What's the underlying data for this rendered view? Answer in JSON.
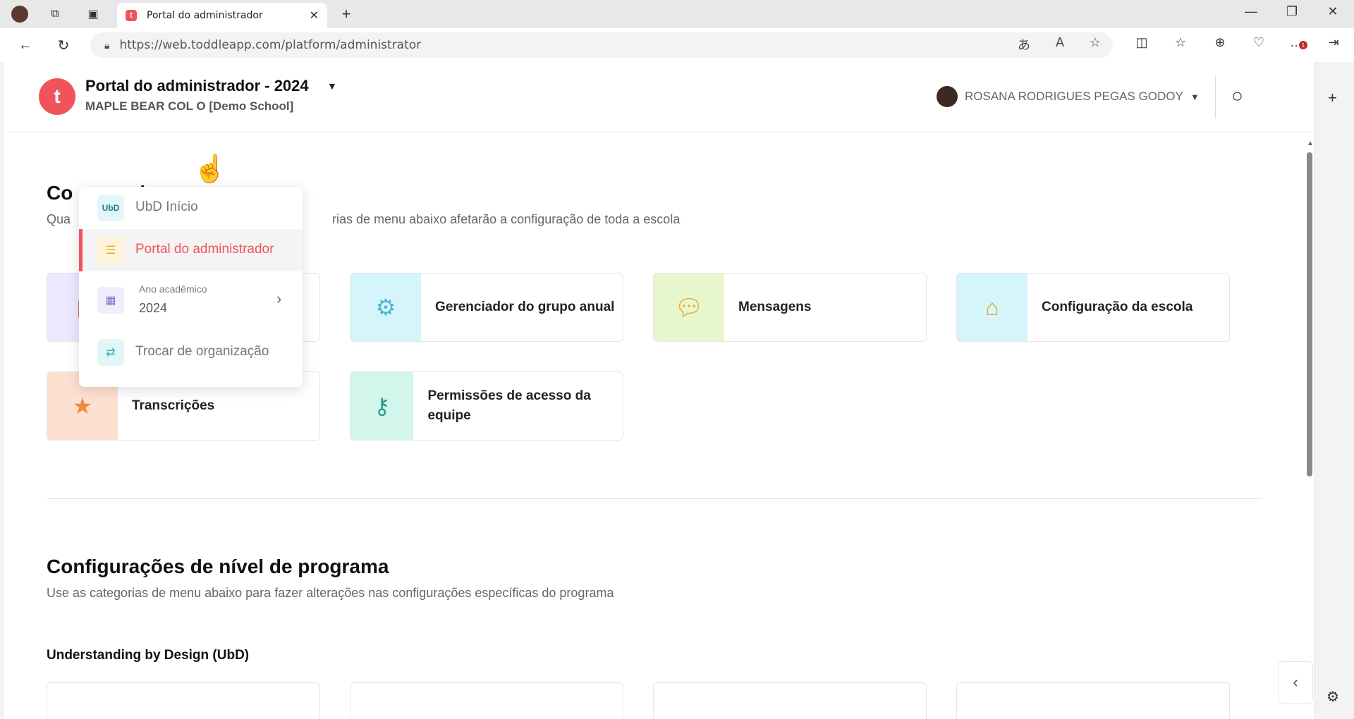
{
  "browser": {
    "tab_title": "Portal do administrador",
    "favicon_letter": "t",
    "url": "https://web.toddleapp.com/platform/administrator",
    "notification_count": "1"
  },
  "header": {
    "logo_letter": "t",
    "portal_title": "Portal do administrador - 2024",
    "school_name": "MAPLE BEAR COL    O [Demo School]",
    "user_name": "ROSANA RODRIGUES PEGAS GODOY"
  },
  "dropdown": {
    "items": [
      {
        "label": "UbD Início",
        "icon_text": "UbD"
      },
      {
        "label": "Portal do administrador"
      },
      {
        "label": "Ano acadêmico",
        "value": "2024"
      },
      {
        "label": "Trocar de organização"
      }
    ]
  },
  "school_section": {
    "title_visible": "Co                       a escola",
    "subtitle_left": "Qua",
    "subtitle_right": "rias de menu abaixo afetarão a configuração de toda a escola",
    "cards": [
      {
        "label": ""
      },
      {
        "label": "Gerenciador do grupo anual"
      },
      {
        "label": "Mensagens"
      },
      {
        "label": "Configuração da escola"
      },
      {
        "label": "Transcrições"
      },
      {
        "label": "Permissões de acesso da equipe"
      }
    ]
  },
  "program_section": {
    "title": "Configurações de nível de programa",
    "subtitle": "Use as categorias de menu abaixo para fazer alterações nas configurações específicas do programa",
    "subheading": "Understanding by Design (UbD)"
  },
  "colors": {
    "brand": "#f0535a"
  }
}
